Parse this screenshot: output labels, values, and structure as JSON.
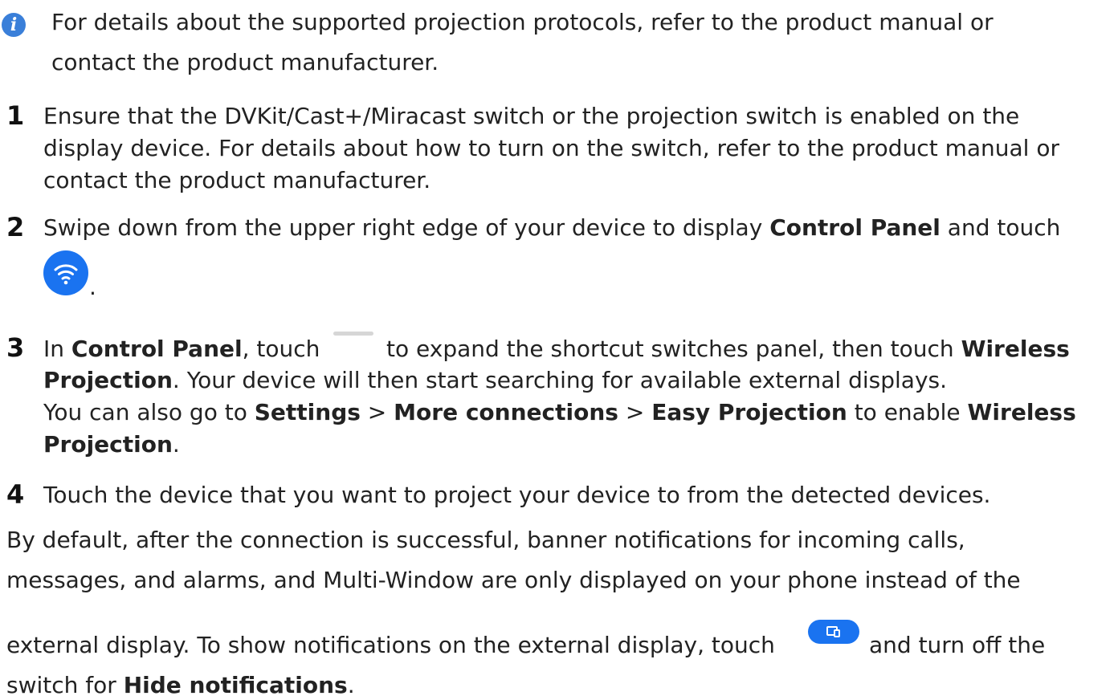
{
  "note": {
    "line1": "For details about the supported projection protocols, refer to the product manual or",
    "line2": "contact the product manufacturer.",
    "icon": "info-icon",
    "icon_color": "#3a7fd9"
  },
  "steps": [
    {
      "number": "1",
      "line1": "Ensure that the DVKit/Cast+/Miracast switch or the projection switch is enabled on the",
      "line2": "display device. For details about how to turn on the switch, refer to the product manual or",
      "line3": "contact the product manufacturer."
    },
    {
      "number": "2",
      "text_before": "Swipe down from the upper right edge of your device to display ",
      "bold": "Control Panel",
      "text_after": " and touch",
      "icon": "wifi-icon",
      "icon_color": "#1a73f0",
      "end": "."
    },
    {
      "number": "3",
      "line1_pre": "In ",
      "line1_bold": "Control Panel",
      "line1_mid": ", touch",
      "line1_post": "to expand the shortcut switches panel, then touch ",
      "line1_bold2": "Wireless",
      "line2_bold": "Projection",
      "line2_rest": ". Your device will then start searching for available external displays.",
      "line3_pre": "You can also go to ",
      "line3_b1": "Settings",
      "line3_gt1": " > ",
      "line3_b2": "More connections",
      "line3_gt2": " > ",
      "line3_b3": "Easy Projection",
      "line3_mid": " to enable ",
      "line3_b4": "Wireless",
      "line4_bold": "Projection",
      "line4_end": ".",
      "icon": "expand-handle-icon"
    },
    {
      "number": "4",
      "line1": "Touch the device that you want to project your device to from the detected devices."
    }
  ],
  "footer": {
    "line1": "By default, after the connection is successful, banner notifications for incoming calls,",
    "line2": "messages, and alarms, and Multi-Window are only displayed on your phone instead of the",
    "line3_pre": "external display. To show notifications on the external display, touch",
    "line3_post": "and turn off the",
    "line4_pre": "switch for ",
    "line4_bold": "Hide notifications",
    "line4_end": ".",
    "icon": "projection-icon",
    "icon_color": "#1a73f0"
  }
}
